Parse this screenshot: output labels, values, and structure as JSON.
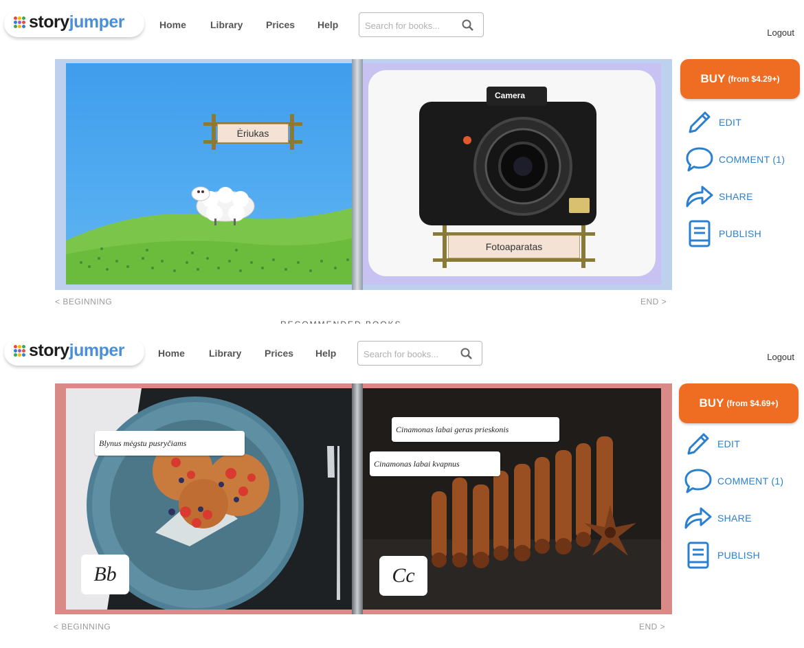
{
  "brand": {
    "logo_word_1": "story",
    "logo_word_2": "jumper"
  },
  "nav": {
    "home": "Home",
    "library": "Library",
    "prices": "Prices",
    "help": "Help"
  },
  "search": {
    "placeholder": "Search for books..."
  },
  "account": {
    "logout": "Logout"
  },
  "sidebar": {
    "edit": "EDIT",
    "comment": "COMMENT (1)",
    "share": "SHARE",
    "publish": "PUBLISH"
  },
  "pager": {
    "beginning": "< BEGINNING",
    "end": "END >"
  },
  "colors": {
    "accent": "#ef6d22",
    "link": "#2a7fd0",
    "book1_frame": "#bdd0ee",
    "book2_frame": "#d98a86"
  },
  "screens": [
    {
      "buy_main": "BUY",
      "buy_price": "(from $4.29+)",
      "left_caption": "Ėriukas",
      "camera_label": "Camera",
      "right_caption": "Fotoaparatas"
    },
    {
      "buy_main": "BUY",
      "buy_price": "(from $4.69+)",
      "left_text": "Blynus mėgstu pusryčiams",
      "left_letters": "Bb",
      "right_text_1": "Cinamonas labai geras prieskonis",
      "right_text_2": "Cinamonas labai kvapnus",
      "right_letters": "Cc"
    }
  ],
  "partial_heading": "RECOMMENDED BOOKS"
}
